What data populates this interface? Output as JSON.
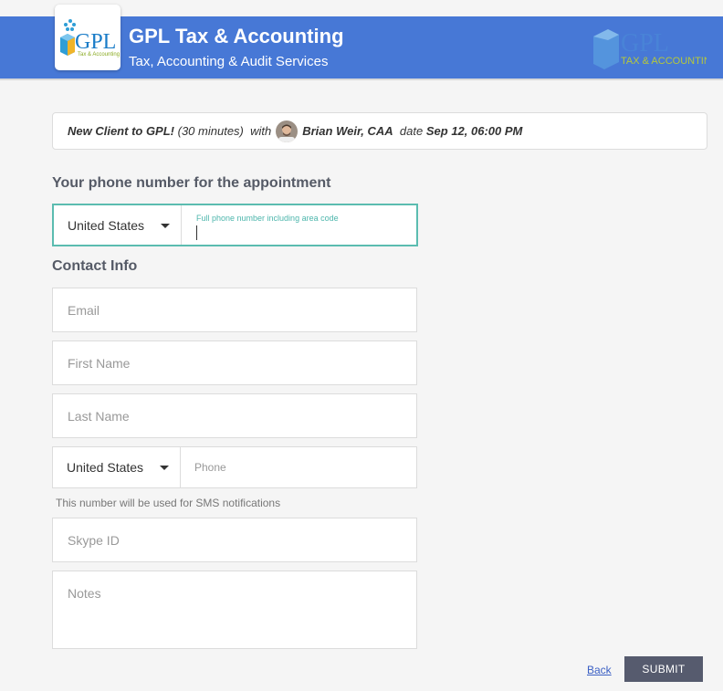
{
  "header": {
    "title": "GPL Tax & Accounting",
    "subtitle": "Tax, Accounting & Audit Services",
    "logo_text": "GPL",
    "logo_tagline": "Tax & Accounting",
    "logo_right_text": "GPL",
    "logo_right_tagline": "TAX & ACCOUNTING",
    "color": "#4778d6"
  },
  "appointment": {
    "service": "New Client to GPL!",
    "duration": "(30 minutes)",
    "with_label": "with",
    "provider": "Brian Weir, CAA",
    "date_label": "date",
    "date": "Sep 12, 06:00 PM"
  },
  "phone_section": {
    "title": "Your phone number for the appointment",
    "country": "United States",
    "label": "Full phone number including area code",
    "value": ""
  },
  "contact": {
    "title": "Contact Info",
    "email_placeholder": "Email",
    "first_name_placeholder": "First Name",
    "last_name_placeholder": "Last Name",
    "phone_country": "United States",
    "phone_placeholder": "Phone",
    "phone_hint": "This number will be used for SMS notifications",
    "skype_placeholder": "Skype ID",
    "notes_placeholder": "Notes"
  },
  "actions": {
    "back_label": "Back",
    "submit_label": "SUBMIT"
  }
}
